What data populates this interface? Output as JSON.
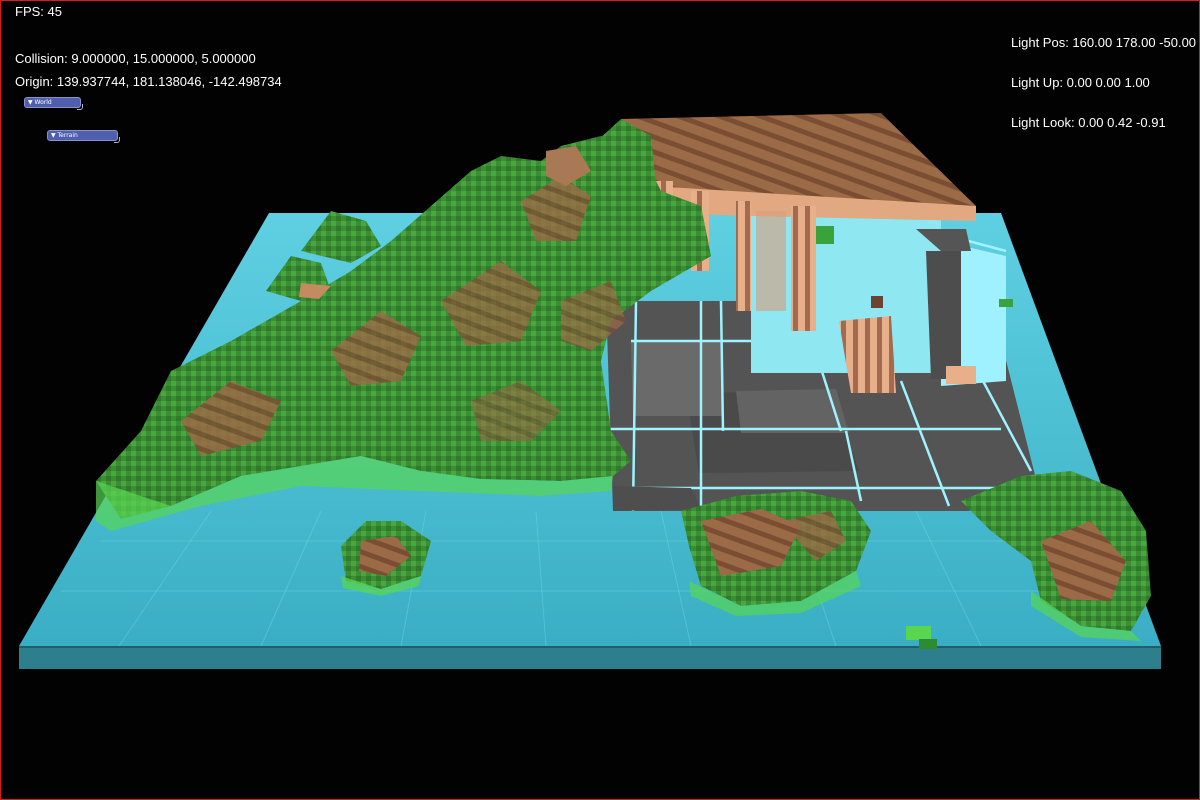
{
  "hud": {
    "fps": "FPS: 45",
    "collision": "Collision: 9.000000, 15.000000, 5.000000",
    "origin": "Origin: 139.937744, 181.138046, -142.498734",
    "light_pos": "Light Pos: 160.00 178.00 -50.00",
    "light_up": "Light Up: 0.00 0.00 1.00",
    "light_look": "Light Look: 0.00 0.42 -0.91"
  },
  "panels": {
    "world": "▼ World",
    "terrain": "▼ Terrain"
  },
  "colors": {
    "border": "#d81b1b",
    "water": "#3fb8cc",
    "grass": "#3f9a35",
    "dirt": "#a0704c",
    "stone_floor": "#5a5a5a",
    "glow": "#9ff3ff"
  }
}
